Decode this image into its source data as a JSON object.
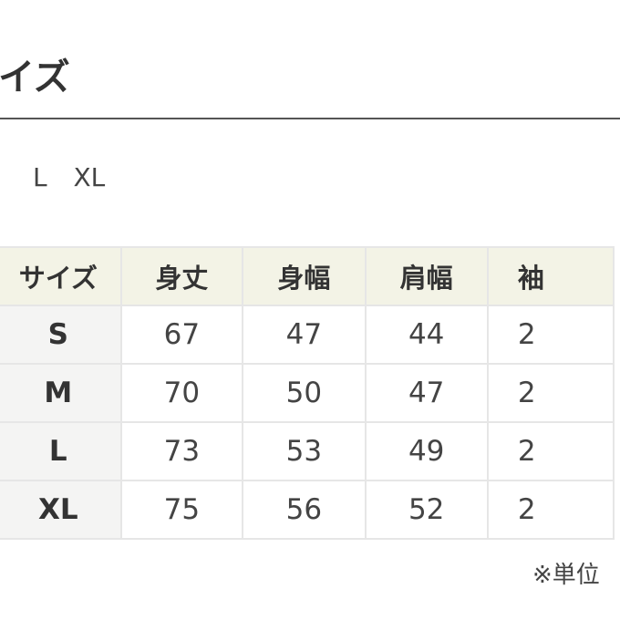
{
  "title": "イズ",
  "size_options": "L XL",
  "table": {
    "headers": [
      "サイズ",
      "身丈",
      "身幅",
      "肩幅",
      "袖"
    ],
    "rows": [
      [
        "S",
        "67",
        "47",
        "44",
        "2"
      ],
      [
        "M",
        "70",
        "50",
        "47",
        "2"
      ],
      [
        "L",
        "73",
        "53",
        "49",
        "2"
      ],
      [
        "XL",
        "75",
        "56",
        "52",
        "2"
      ]
    ]
  },
  "note": "※単位"
}
